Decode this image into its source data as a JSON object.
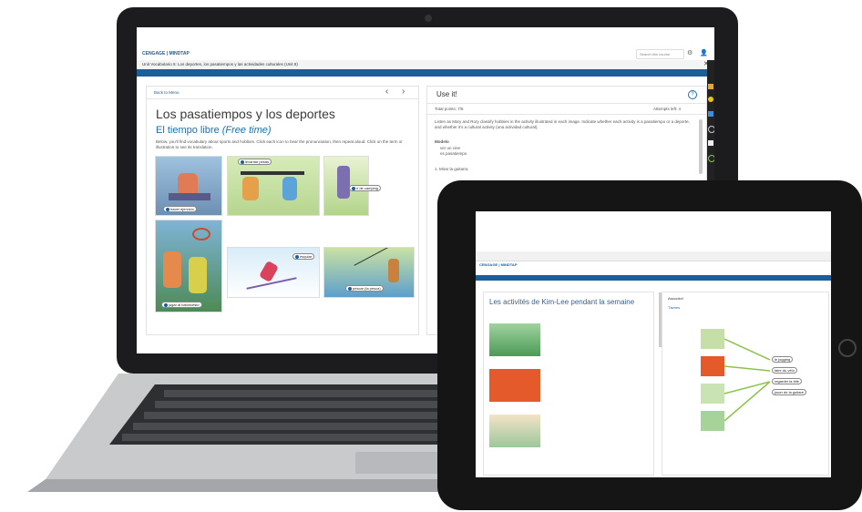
{
  "laptop": {
    "brand_logo": "CENGAGE | MINDTAP",
    "search_placeholder": "Search this course",
    "breadcrumb": "Unit Vocabulario 5: Los deportes, los pasatiempos y las actividades culturales (Unit 8)",
    "back_link": "Back to Menu",
    "page_title": "Los pasatiempos y los deportes",
    "section_title": "El tiempo libre",
    "section_title_italic": "(Free time)",
    "intro_text": "Below, you'll find vocabulary about sports and hobbies. Click each icon to hear the pronunciation, then repeat aloud. Click on the term or illustration to see its translation.",
    "labels": [
      "levantar pesas",
      "hacer ejercicio",
      "ir de camping",
      "jugar al baloncesto",
      "esquiar",
      "pescar (la pesca)"
    ],
    "right_panel": {
      "title": "Use it!",
      "subheader_left": "Total points: 7/6",
      "subheader_right": "Attempts left: 4",
      "instructions": "Listen as Mary and Rory classify hobbies in the activity illustrated in each image. Indicate whether each activity is a pasatiempo or a deporte, and whether it's a cultural activity (una actividad cultural).",
      "model_label": "Modelo",
      "model_lines": [
        "ver un cine",
        "es pasatiempo"
      ],
      "footer_text": "1. Mirar la guitarra"
    }
  },
  "tablet": {
    "app_name": "CENGAGE | MINDTAP",
    "page_title": "Les activités de Kim-Lee pendant la semaine",
    "right_title": "Associez!",
    "right_tab": "Tâches",
    "match_options": [
      "le jogging",
      "faire du vélo",
      "regarder la télé",
      "jouer de la guitare"
    ]
  }
}
